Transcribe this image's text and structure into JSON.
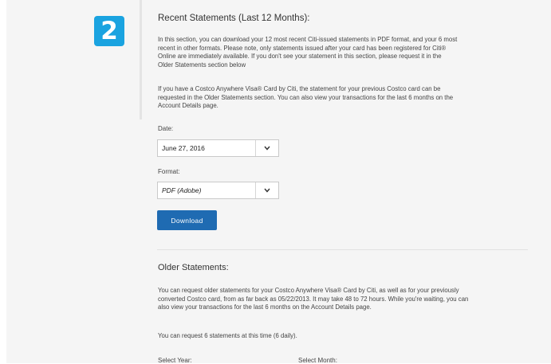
{
  "step_badge": "2",
  "recent": {
    "heading": "Recent Statements (Last 12 Months):",
    "intro_lines": [
      "In this section, you can download your 12 most recent Citi-issued statements in PDF format, and your 6 most",
      "recent in other formats. Please note, only statements issued after your card has been registered for Citi®",
      "Online are immediately available. If you don't see your statement in this section, please request it in the",
      "Older Statements section below"
    ],
    "costco_lines": [
      "If you have a Costco Anywhere Visa® Card by Citi, the statement for your previous Costco card can be",
      "requested in the Older Statements section. You can also view your transactions for the last 6 months on the",
      "Account Details page."
    ],
    "date_label": "Date:",
    "date_value": "June 27, 2016",
    "format_label": "Format:",
    "format_value": "PDF (Adobe)",
    "download_label": "Download"
  },
  "older": {
    "heading": "Older Statements:",
    "lines": [
      "You can request older statements for your Costco Anywhere Visa® Card by Citi, as well as for your previously",
      "converted Costco card, from as far back as 05/22/2013. It may take 48 to 72 hours. While you're waiting, you can",
      "also view your transactions for the last 6 months on the Account Details page."
    ],
    "limit_text": "You can request 6 statements at this time (6 daily).",
    "select_year_label": "Select Year:",
    "select_month_label": "Select Month:"
  }
}
